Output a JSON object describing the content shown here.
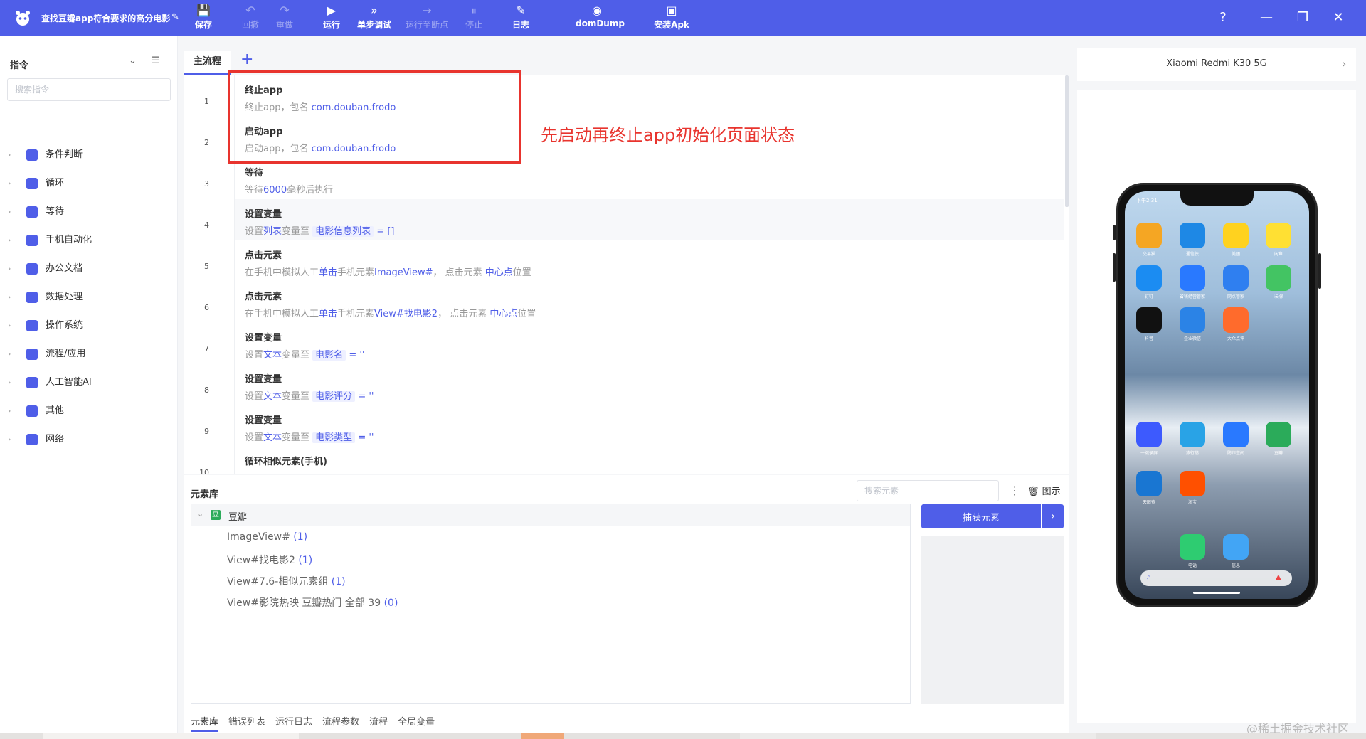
{
  "app": {
    "title": "查找豆瓣app符合要求的高分电影",
    "edit_icon": "✎"
  },
  "toolbar": [
    {
      "label": "保存",
      "icon": "💾",
      "enabled": true
    },
    {
      "label": "回撤",
      "icon": "↶",
      "enabled": false
    },
    {
      "label": "重做",
      "icon": "↷",
      "enabled": false
    },
    {
      "label": "运行",
      "icon": "▶",
      "enabled": true
    },
    {
      "label": "单步调试",
      "icon": "»",
      "enabled": true
    },
    {
      "label": "运行至断点",
      "icon": "→",
      "enabled": false
    },
    {
      "label": "停止",
      "icon": "⏸",
      "enabled": false
    },
    {
      "label": "日志",
      "icon": "✎",
      "enabled": true
    },
    {
      "label": "domDump",
      "icon": "◉",
      "enabled": true
    },
    {
      "label": "安装Apk",
      "icon": "▣",
      "enabled": true
    }
  ],
  "window_controls": {
    "help": "?",
    "minimize": "—",
    "restore": "❐",
    "close": "✕"
  },
  "commands": {
    "title": "指令",
    "search_placeholder": "搜索指令",
    "items": [
      {
        "label": "条件判断",
        "color": "#4f5ee8"
      },
      {
        "label": "循环",
        "color": "#4f5ee8"
      },
      {
        "label": "等待",
        "color": "#4f5ee8"
      },
      {
        "label": "手机自动化",
        "color": "#4f5ee8"
      },
      {
        "label": "办公文档",
        "color": "#4f5ee8"
      },
      {
        "label": "数据处理",
        "color": "#4f5ee8"
      },
      {
        "label": "操作系统",
        "color": "#4f5ee8"
      },
      {
        "label": "流程/应用",
        "color": "#4f5ee8"
      },
      {
        "label": "人工智能AI",
        "color": "#4f5ee8"
      },
      {
        "label": "其他",
        "color": "#4f5ee8"
      },
      {
        "label": "网络",
        "color": "#4f5ee8"
      }
    ]
  },
  "editor": {
    "tab": "主流程",
    "add_tab": "+",
    "annotation": "先启动再终止app初始化页面状态",
    "lines": [
      "1",
      "2",
      "3",
      "4",
      "5",
      "6",
      "7",
      "8",
      "9",
      "10"
    ],
    "steps": [
      {
        "title": "终止app",
        "parts": [
          [
            "终止app，包名 ",
            ""
          ],
          [
            "com.douban.frodo",
            "kw"
          ]
        ]
      },
      {
        "title": "启动app",
        "parts": [
          [
            "启动app，包名 ",
            ""
          ],
          [
            "com.douban.frodo",
            "kw"
          ]
        ]
      },
      {
        "title": "等待",
        "parts": [
          [
            "等待",
            ""
          ],
          [
            "6000",
            "kw"
          ],
          [
            "毫秒后执行",
            ""
          ]
        ]
      },
      {
        "title": "设置变量",
        "parts": [
          [
            "设置",
            ""
          ],
          [
            "列表",
            "kw"
          ],
          [
            "变量至 ",
            ""
          ],
          [
            "电影信息列表",
            "var"
          ],
          [
            " = []",
            "kw"
          ]
        ]
      },
      {
        "title": "点击元素",
        "parts": [
          [
            "在手机中模拟人工",
            ""
          ],
          [
            "单击",
            "kw"
          ],
          [
            "手机元素",
            ""
          ],
          [
            "ImageView#",
            "kw"
          ],
          [
            "， 点击元素 ",
            ""
          ],
          [
            "中心点",
            "kw"
          ],
          [
            "位置",
            ""
          ]
        ]
      },
      {
        "title": "点击元素",
        "parts": [
          [
            "在手机中模拟人工",
            ""
          ],
          [
            "单击",
            "kw"
          ],
          [
            "手机元素",
            ""
          ],
          [
            "View#找电影2",
            "kw"
          ],
          [
            "， 点击元素 ",
            ""
          ],
          [
            "中心点",
            "kw"
          ],
          [
            "位置",
            ""
          ]
        ]
      },
      {
        "title": "设置变量",
        "parts": [
          [
            "设置",
            ""
          ],
          [
            "文本",
            "kw"
          ],
          [
            "变量至 ",
            ""
          ],
          [
            "电影名",
            "var"
          ],
          [
            " =  ''",
            "kw"
          ]
        ]
      },
      {
        "title": "设置变量",
        "parts": [
          [
            "设置",
            ""
          ],
          [
            "文本",
            "kw"
          ],
          [
            "变量至 ",
            ""
          ],
          [
            "电影评分",
            "var"
          ],
          [
            " = ''",
            "kw"
          ]
        ]
      },
      {
        "title": "设置变量",
        "parts": [
          [
            "设置",
            ""
          ],
          [
            "文本",
            "kw"
          ],
          [
            "变量至 ",
            ""
          ],
          [
            "电影类型",
            "var"
          ],
          [
            " = ''",
            "kw"
          ]
        ]
      },
      {
        "title": "循环相似元素(手机)",
        "parts": []
      }
    ]
  },
  "element_library": {
    "title": "元素库",
    "search_placeholder": "搜索元素",
    "preview_label": "图示",
    "root": "豆瓣",
    "root_icon": "豆",
    "items": [
      {
        "name": "ImageView#",
        "count": "(1)"
      },
      {
        "name": "View#找电影2",
        "count": "(1)"
      },
      {
        "name": "View#7.6-相似元素组",
        "count": "(1)"
      },
      {
        "name": "View#影院热映 豆瓣热门 全部 39",
        "count": "(0)"
      }
    ],
    "capture_button": "捕获元素",
    "capture_arrow": "›"
  },
  "bottom_tabs": [
    "元素库",
    "错误列表",
    "运行日志",
    "流程参数",
    "流程",
    "全局变量"
  ],
  "device": {
    "name": "Xiaomi Redmi K30 5G",
    "status_time": "下午2:31",
    "apps": [
      {
        "name": "交易猫",
        "color": "#f5a623"
      },
      {
        "name": "通信侠",
        "color": "#1e88e5"
      },
      {
        "name": "美团",
        "color": "#ffd21f"
      },
      {
        "name": "闲鱼",
        "color": "#ffe033"
      },
      {
        "name": "钉钉",
        "color": "#1b8cf2"
      },
      {
        "name": "省钱经营管家",
        "color": "#2979ff"
      },
      {
        "name": "网点管家",
        "color": "#2f7ff0"
      },
      {
        "name": "i云保",
        "color": "#43c463"
      },
      {
        "name": "抖音",
        "color": "#111111"
      },
      {
        "name": "企业微信",
        "color": "#2b83e6"
      },
      {
        "name": "大众点评",
        "color": "#ff6b2c"
      },
      {
        "name": "一键录屏",
        "color": "#3d5afe"
      },
      {
        "name": "旅行翁",
        "color": "#29a3e6"
      },
      {
        "name": "防诈空间",
        "color": "#2979ff"
      },
      {
        "name": "豆瓣",
        "color": "#2bab5a"
      },
      {
        "name": "天眼查",
        "color": "#1976d2"
      },
      {
        "name": "淘宝",
        "color": "#ff5000"
      },
      {
        "name": "电话",
        "color": "#2ecc71"
      },
      {
        "name": "信息",
        "color": "#42a5f5"
      }
    ]
  },
  "watermark": "@稀土掘金技术社区"
}
